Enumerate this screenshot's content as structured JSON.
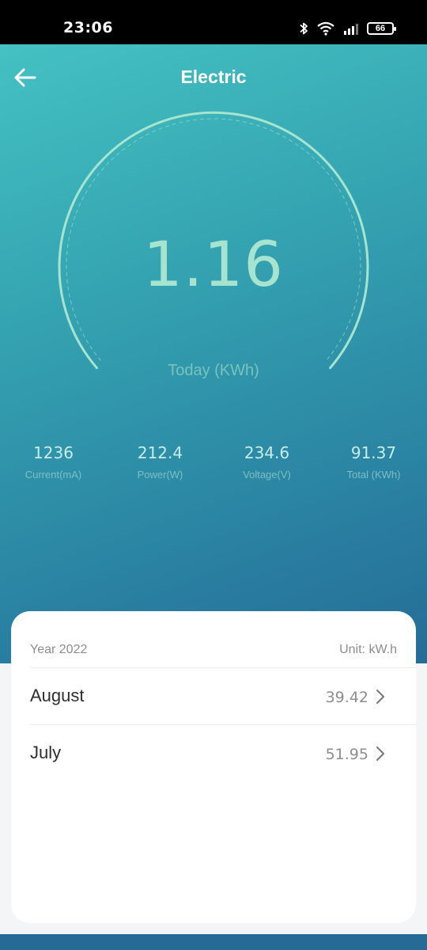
{
  "status_bar": {
    "time": "23:06",
    "battery": "66",
    "icons": [
      "bluetooth-icon",
      "wifi-icon",
      "signal-icon",
      "battery-icon"
    ]
  },
  "header": {
    "title": "Electric",
    "back_icon": "arrow-left-icon"
  },
  "gauge": {
    "value": "1.16",
    "label": "Today (KWh)"
  },
  "stats": [
    {
      "value": "1236",
      "label": "Current(mA)"
    },
    {
      "value": "212.4",
      "label": "Power(W)"
    },
    {
      "value": "234.6",
      "label": "Voltage(V)"
    },
    {
      "value": "91.37",
      "label": "Total (KWh)"
    }
  ],
  "history": {
    "year": "Year 2022",
    "unit": "Unit: kW.h",
    "months": [
      {
        "name": "August",
        "value": "39.42"
      },
      {
        "name": "July",
        "value": "51.95"
      }
    ]
  },
  "colors": {
    "gradient_start": "#44c1c2",
    "gradient_end": "#256c97",
    "gauge_accent": "#a7e4cf"
  }
}
